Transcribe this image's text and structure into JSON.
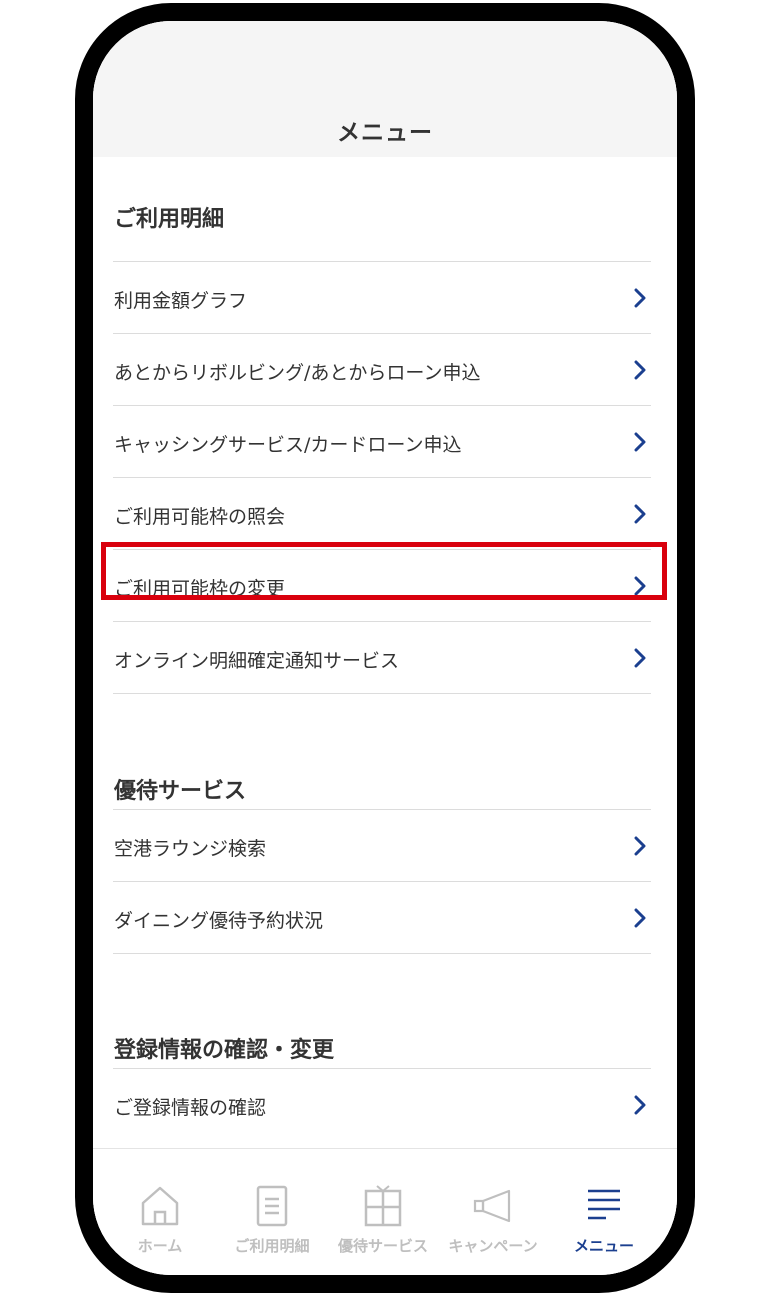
{
  "header": {
    "title": "メニュー"
  },
  "sections": [
    {
      "title": "ご利用明細",
      "items": [
        {
          "label": "利用金額グラフ"
        },
        {
          "label": "あとからリボルビング/あとからローン申込"
        },
        {
          "label": "キャッシングサービス/カードローン申込"
        },
        {
          "label": "ご利用可能枠の照会"
        },
        {
          "label": "ご利用可能枠の変更",
          "highlighted": true
        },
        {
          "label": "オンライン明細確定通知サービス"
        }
      ]
    },
    {
      "title": "優待サービス",
      "items": [
        {
          "label": "空港ラウンジ検索"
        },
        {
          "label": "ダイニング優待予約状況"
        }
      ]
    },
    {
      "title": "登録情報の確認・変更",
      "items": [
        {
          "label": "ご登録情報の確認"
        }
      ]
    }
  ],
  "tabbar": {
    "tabs": [
      {
        "label": "ホーム",
        "icon": "home-icon",
        "active": false
      },
      {
        "label": "ご利用明細",
        "icon": "statement-icon",
        "active": false
      },
      {
        "label": "優待サービス",
        "icon": "gift-icon",
        "active": false
      },
      {
        "label": "キャンペーン",
        "icon": "megaphone-icon",
        "active": false
      },
      {
        "label": "メニュー",
        "icon": "menu-icon",
        "active": true
      }
    ]
  },
  "colors": {
    "accent": "#1b3f8f",
    "highlight": "#d9000d",
    "inactive": "#bfbfbf",
    "text": "#333333"
  }
}
